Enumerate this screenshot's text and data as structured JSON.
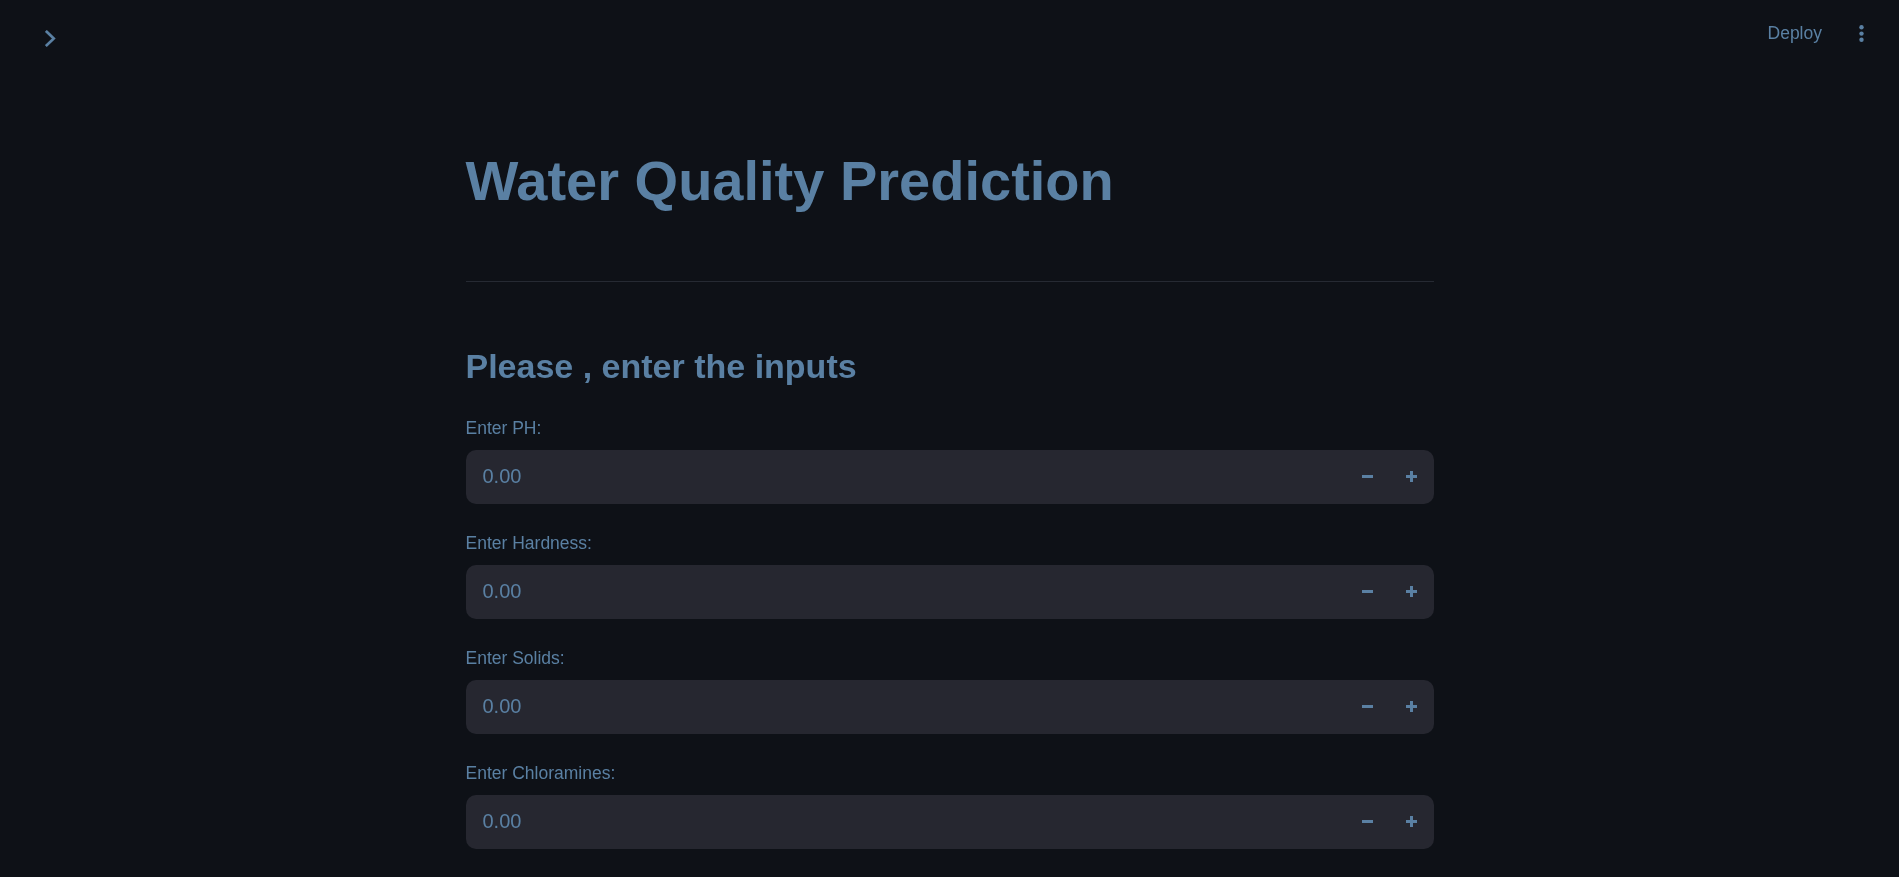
{
  "header": {
    "deploy_label": "Deploy"
  },
  "title": "Water Quality Prediction",
  "subheader": "Please , enter the inputs",
  "inputs": [
    {
      "label": "Enter PH:",
      "value": "0.00"
    },
    {
      "label": "Enter Hardness:",
      "value": "0.00"
    },
    {
      "label": "Enter Solids:",
      "value": "0.00"
    },
    {
      "label": "Enter Chloramines:",
      "value": "0.00"
    }
  ]
}
